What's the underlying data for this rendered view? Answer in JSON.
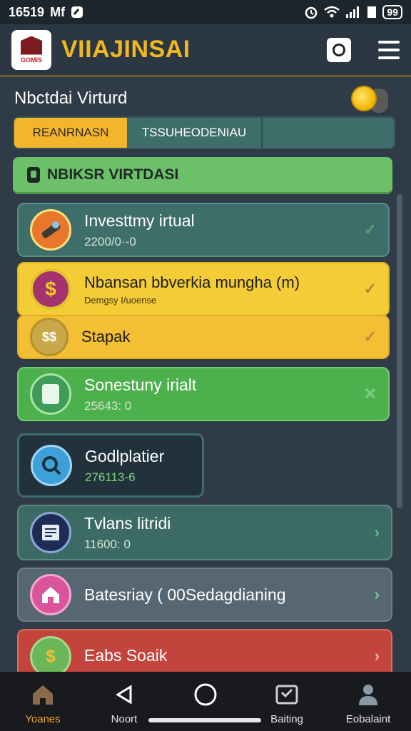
{
  "status_bar": {
    "time": "16519",
    "carrier": "Mf",
    "battery": "99"
  },
  "header": {
    "logo_text": "GOMIS",
    "title": "VIIAJINSAI"
  },
  "section": {
    "title": "Nbctdai Virturd"
  },
  "tabs": [
    {
      "label": "REANRNASN",
      "active": true
    },
    {
      "label": "TSSUHEODENIAU",
      "active": false
    },
    {
      "label": "",
      "active": false
    }
  ],
  "banner": {
    "label": "NBIKSR VIRTDASI"
  },
  "cards": [
    {
      "title": "Investtmy irtual",
      "subtitle": "2200/0·-0",
      "icon": "money-tube-icon",
      "status": "check"
    },
    {
      "title": "Nbansan bbverkia mungha (m)",
      "subtitle": "Demgsy I/uoense",
      "icon": "dollar-icon",
      "status": "check"
    },
    {
      "title": "Stapak",
      "subtitle": "",
      "icon": "coins-icon",
      "status": "check"
    },
    {
      "title": "Sonestuny irialt",
      "subtitle": "25643: 0",
      "icon": "document-icon",
      "status": "x"
    },
    {
      "title": "Godlplatier",
      "subtitle": "276113-6",
      "icon": "magnifier-icon",
      "status": ""
    },
    {
      "title": "Tvlans litridi",
      "subtitle": "11600: 0",
      "icon": "ledger-icon",
      "status": "chevron"
    },
    {
      "title": "Batesriay ( 00Sedagdianing",
      "subtitle": "",
      "icon": "house-icon",
      "status": "chevron"
    },
    {
      "title": "Eabs Soaik",
      "subtitle": "",
      "icon": "cash-icon",
      "status": "chevron"
    }
  ],
  "bottom_nav": [
    {
      "label": "Yoanes",
      "icon": "home-icon",
      "active": true
    },
    {
      "label": "Noort",
      "icon": "back-icon",
      "active": false
    },
    {
      "label": "",
      "icon": "circle-home-icon",
      "active": false
    },
    {
      "label": "Baiting",
      "icon": "inbox-icon",
      "active": false
    },
    {
      "label": "Eobalaint",
      "icon": "person-icon",
      "active": false
    }
  ],
  "colors": {
    "accent": "#f2b820",
    "background": "#2f3c48",
    "tab_active": "#f5b52a",
    "banner": "#6cc06a"
  }
}
